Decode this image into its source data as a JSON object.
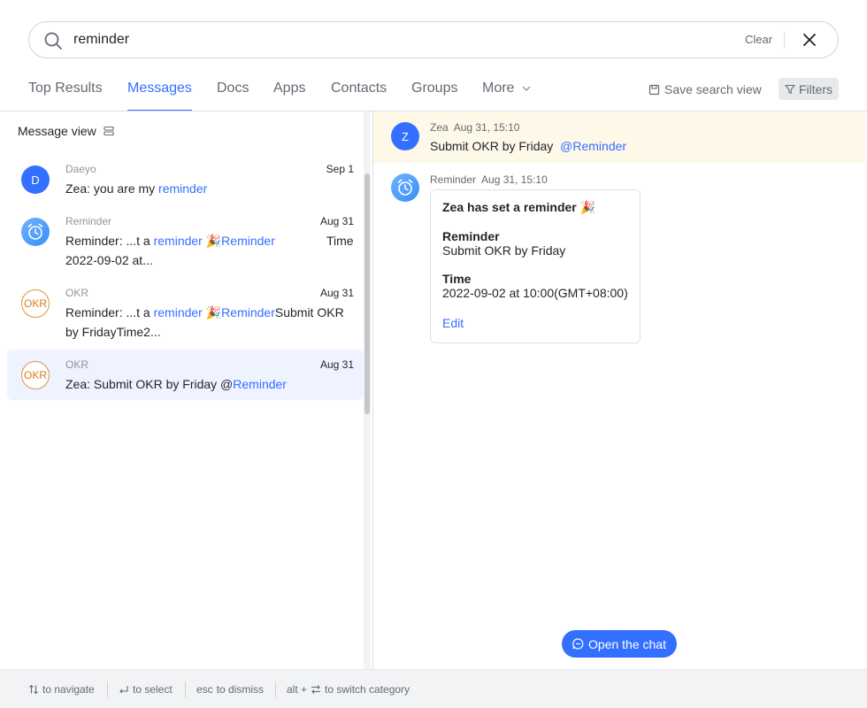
{
  "search": {
    "value": "reminder",
    "clear_label": "Clear"
  },
  "tabs": [
    {
      "label": "Top Results"
    },
    {
      "label": "Messages"
    },
    {
      "label": "Docs"
    },
    {
      "label": "Apps"
    },
    {
      "label": "Contacts"
    },
    {
      "label": "Groups"
    },
    {
      "label": "More"
    }
  ],
  "active_tab": "Messages",
  "toolbar": {
    "save_view_label": "Save search view",
    "filters_label": "Filters"
  },
  "left": {
    "view_label": "Message view",
    "results": [
      {
        "avatar": "D",
        "sender": "Daeyo",
        "date": "Sep 1",
        "line1_pre": "Zea: you are my ",
        "line1_hl": "reminder"
      },
      {
        "sender": "Reminder",
        "date": "Aug 31",
        "line1_pre": "Reminder: ...t a ",
        "line1_hl": "reminder",
        "line1_hl2": "Reminder",
        "line1_post": "Time",
        "line2": "2022-09-02 at..."
      },
      {
        "avatar": "OKR",
        "sender": "OKR",
        "date": "Aug 31",
        "line1_pre": "Reminder: ...t a ",
        "line1_hl": "reminder",
        "line1_hl2": "Reminder",
        "line1_post": "Submit OKR",
        "line2": "by FridayTime2..."
      },
      {
        "avatar": "OKR",
        "sender": "OKR",
        "date": "Aug 31",
        "line1_pre": "Zea: Submit OKR by Friday @",
        "line1_hl": "Reminder"
      }
    ]
  },
  "detail": {
    "msg1": {
      "avatar": "Z",
      "sender": "Zea",
      "time": "Aug 31, 15:10",
      "text": "Submit OKR by Friday",
      "mention": "@Reminder"
    },
    "msg2": {
      "sender": "Reminder",
      "time": "Aug 31, 15:10",
      "card": {
        "title": "Zea has set a reminder",
        "reminder_label": "Reminder",
        "reminder_value": "Submit OKR by Friday",
        "time_label": "Time",
        "time_value": "2022-09-02 at 10:00(GMT+08:00)",
        "edit_label": "Edit"
      }
    },
    "open_chat_label": "Open the chat"
  },
  "footer": {
    "navigate": "to navigate",
    "select": "to select",
    "esc_key": "esc",
    "dismiss": "to dismiss",
    "alt_key": "alt +",
    "switch": "to switch category"
  },
  "colors": {
    "accent": "#3370ff",
    "highlight_bg": "#fdf8e8",
    "selected_bg": "#eef3ff"
  }
}
